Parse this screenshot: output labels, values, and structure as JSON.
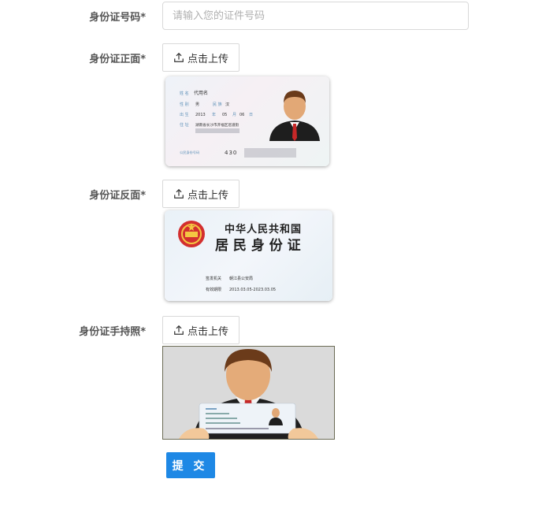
{
  "form": {
    "id_number": {
      "label": "身份证号码*",
      "placeholder": "请输入您的证件号码",
      "value": ""
    },
    "id_front": {
      "label": "身份证正面*",
      "upload_label": "点击上传"
    },
    "id_back": {
      "label": "身份证反面*",
      "upload_label": "点击上传"
    },
    "id_hold": {
      "label": "身份证手持照*",
      "upload_label": "点击上传"
    },
    "submit_label": "提 交"
  },
  "front_card": {
    "name_label": "姓 名",
    "name": "代用名",
    "sex_label": "性 别",
    "sex": "男",
    "ethnicity_label": "民 族",
    "ethnicity": "汉",
    "birth_label": "出 生",
    "birth_year": "2013",
    "birth_year_unit": "年",
    "birth_month": "05",
    "birth_month_unit": "月",
    "birth_day": "06",
    "birth_day_unit": "日",
    "address_label": "住 址",
    "address": "湖南省长沙市开福区巡道街",
    "id_label": "公民身份号码",
    "id_number": "430"
  },
  "back_card": {
    "country": "中华人民共和国",
    "card_title": "居 民 身 份 证",
    "authority_label": "签发机关",
    "authority": "朝江县公安局",
    "validity_label": "有效期限",
    "validity": "2013.03.05-2023.03.05"
  },
  "colors": {
    "primary": "#1e88e5",
    "border": "#d9d9d9",
    "label": "#555555"
  }
}
